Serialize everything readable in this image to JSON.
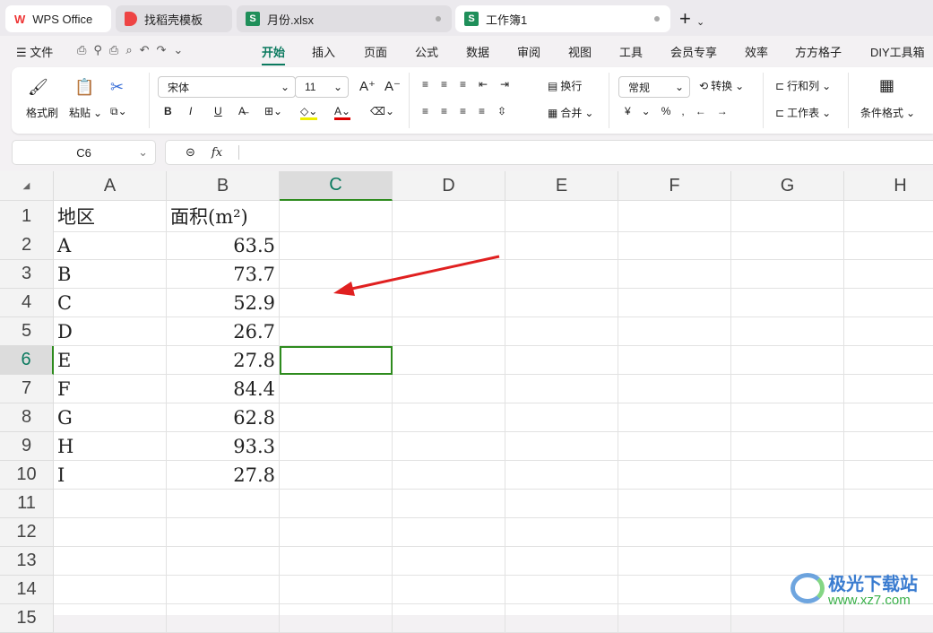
{
  "tabs": [
    {
      "label": "WPS Office"
    },
    {
      "label": "找稻壳模板"
    },
    {
      "label": "月份.xlsx"
    },
    {
      "label": "工作簿1"
    }
  ],
  "menu": {
    "file": "文件",
    "items": [
      "开始",
      "插入",
      "页面",
      "公式",
      "数据",
      "审阅",
      "视图",
      "工具",
      "会员专享",
      "效率",
      "方方格子",
      "DIY工具箱"
    ]
  },
  "ribbon": {
    "format_painter": "格式刷",
    "paste": "粘贴",
    "font": "宋体",
    "size": "11",
    "wrap": "换行",
    "merge": "合并",
    "number_format": "常规",
    "convert": "转换",
    "rows_cols": "行和列",
    "worksheet": "工作表",
    "cond_format": "条件格式",
    "bold": "B",
    "italic": "I",
    "underline": "U"
  },
  "formula_bar": {
    "cell_ref": "C6",
    "fx": "fx",
    "value": ""
  },
  "columns": [
    "A",
    "B",
    "C",
    "D",
    "E",
    "F",
    "G",
    "H"
  ],
  "rows": [
    [
      "地区",
      "面积(m²)"
    ],
    [
      "A",
      "63.5"
    ],
    [
      "B",
      "73.7"
    ],
    [
      "C",
      "52.9"
    ],
    [
      "D",
      "26.7"
    ],
    [
      "E",
      "27.8"
    ],
    [
      "F",
      "84.4"
    ],
    [
      "G",
      "62.8"
    ],
    [
      "H",
      "93.3"
    ],
    [
      "I",
      "27.8"
    ],
    [
      "",
      ""
    ],
    [
      "",
      ""
    ],
    [
      "",
      ""
    ],
    [
      "",
      ""
    ],
    [
      "",
      ""
    ]
  ],
  "selected": {
    "col": "C",
    "row": 6
  },
  "watermark": {
    "name": "极光下载站",
    "url": "www.xz7.com"
  },
  "colors": {
    "accent": "#0b7a5f",
    "selection": "#2e8b1e",
    "arrow": "#e02020"
  }
}
